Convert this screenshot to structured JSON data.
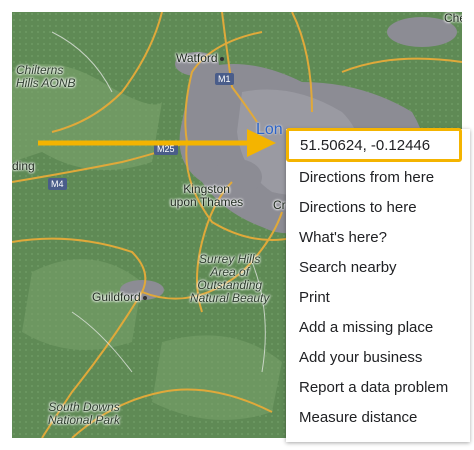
{
  "map": {
    "labels": {
      "watford": "Watford",
      "chilterns": "Chilterns\nHills AONB",
      "london": "Lon",
      "kingston": "Kingston\nupon Thames",
      "surrey": "Surrey Hills\nArea of\nOutstanding\nNatural Beauty",
      "guildford": "Guildford",
      "south_downs": "South Downs\nNational Park",
      "reading": "ding",
      "chelmsford": "Che",
      "croydon": "Cr"
    },
    "shields": {
      "m1": "M1",
      "m25": "M25",
      "m4": "M4"
    }
  },
  "context_menu": {
    "coordinates": "51.50624, -0.12446",
    "items": [
      "Directions from here",
      "Directions to here",
      "What's here?",
      "Search nearby",
      "Print",
      "Add a missing place",
      "Add your business",
      "Report a data problem",
      "Measure distance"
    ]
  },
  "colors": {
    "highlight": "#f4b400",
    "map_green": "#5f8a55",
    "urban": "#8c8c94",
    "road": "#e0a93a"
  }
}
